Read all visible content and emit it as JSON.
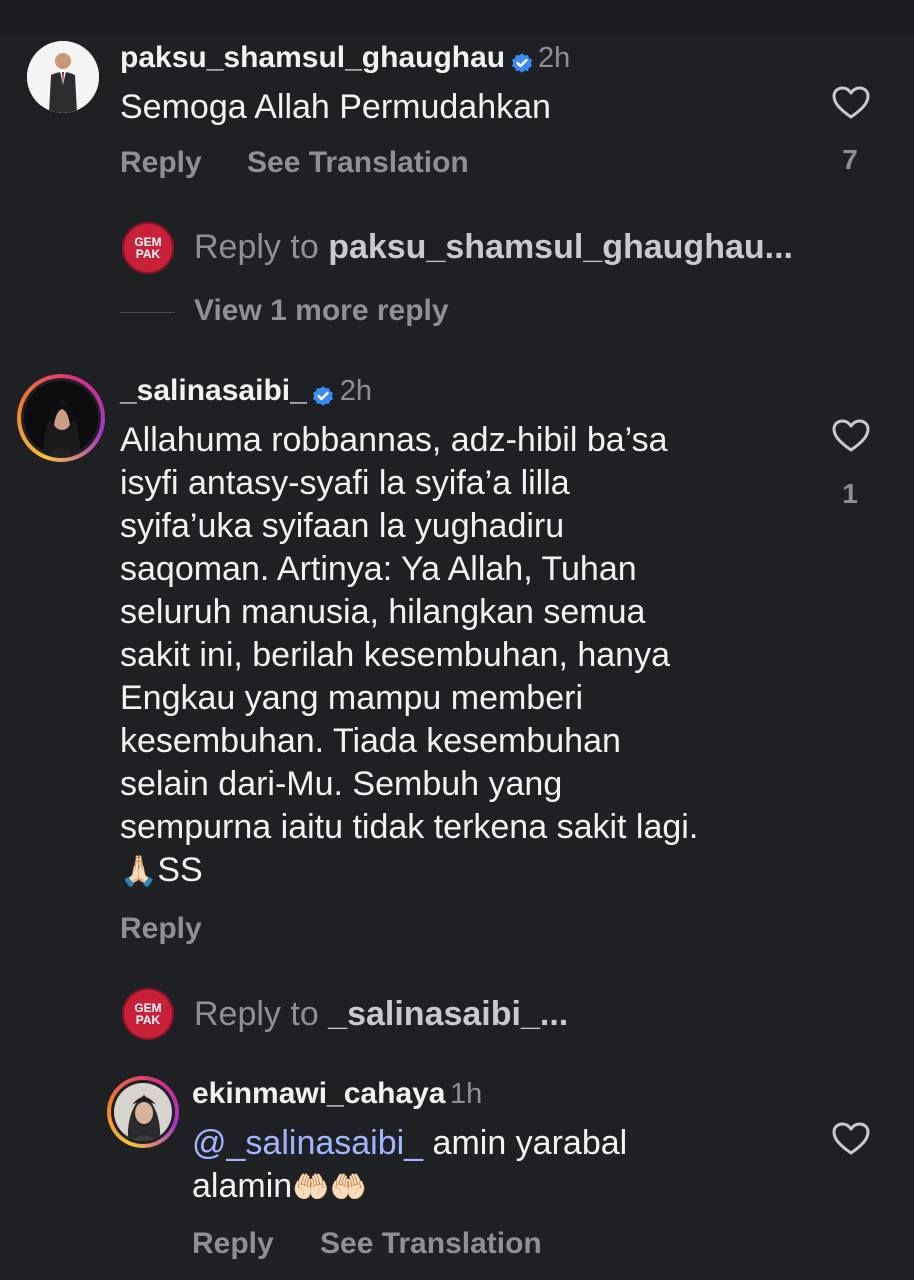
{
  "comments": [
    {
      "username": "paksu_shamsul_ghaughau",
      "time": "2h",
      "text": "Semoga Allah Permudahkan",
      "likes": "7",
      "reply_label": "Reply",
      "translate_label": "See Translation"
    },
    {
      "username": "_salinasaibi_",
      "time": "2h",
      "text_lines": [
        "Allahuma robbannas, adz-hibil ba’sa",
        "isyfi antasy-syafi la syifa’a lilla",
        "syifa’uka syifaan la yughadiru",
        "saqoman. Artinya: Ya Allah, Tuhan",
        "seluruh manusia, hilangkan semua",
        "sakit ini, berilah kesembuhan, hanya",
        "Engkau yang mampu memberi",
        "kesembuhan. Tiada kesembuhan",
        "selain dari-Mu. Sembuh yang",
        "sempurna iaitu tidak terkena sakit lagi."
      ],
      "last_line_emoji": "🙏🏻",
      "last_line_text": "SS",
      "likes": "1",
      "reply_label": "Reply"
    }
  ],
  "reply_prompt_1": {
    "prefix": "Reply to ",
    "target": "paksu_shamsul_ghaughau..."
  },
  "view_more": "View 1 more reply",
  "reply_prompt_2": {
    "prefix": "Reply to ",
    "target": "_salinasaibi_..."
  },
  "nested_reply": {
    "username": "ekinmawi_cahaya",
    "time": "1h",
    "mention": "@_salinasaibi_",
    "text_1": " amin yarabal",
    "text_2": "alamin",
    "emoji": "🤲🏻🤲🏻",
    "reply_label": "Reply",
    "translate_label": "See Translation"
  },
  "gempak_logo_text": [
    "GEM",
    "PAK"
  ],
  "colors": {
    "background": "#1f2024",
    "verified": "#3b8bf5",
    "gempak": "#c9203a",
    "mention": "#9fb6ff"
  }
}
